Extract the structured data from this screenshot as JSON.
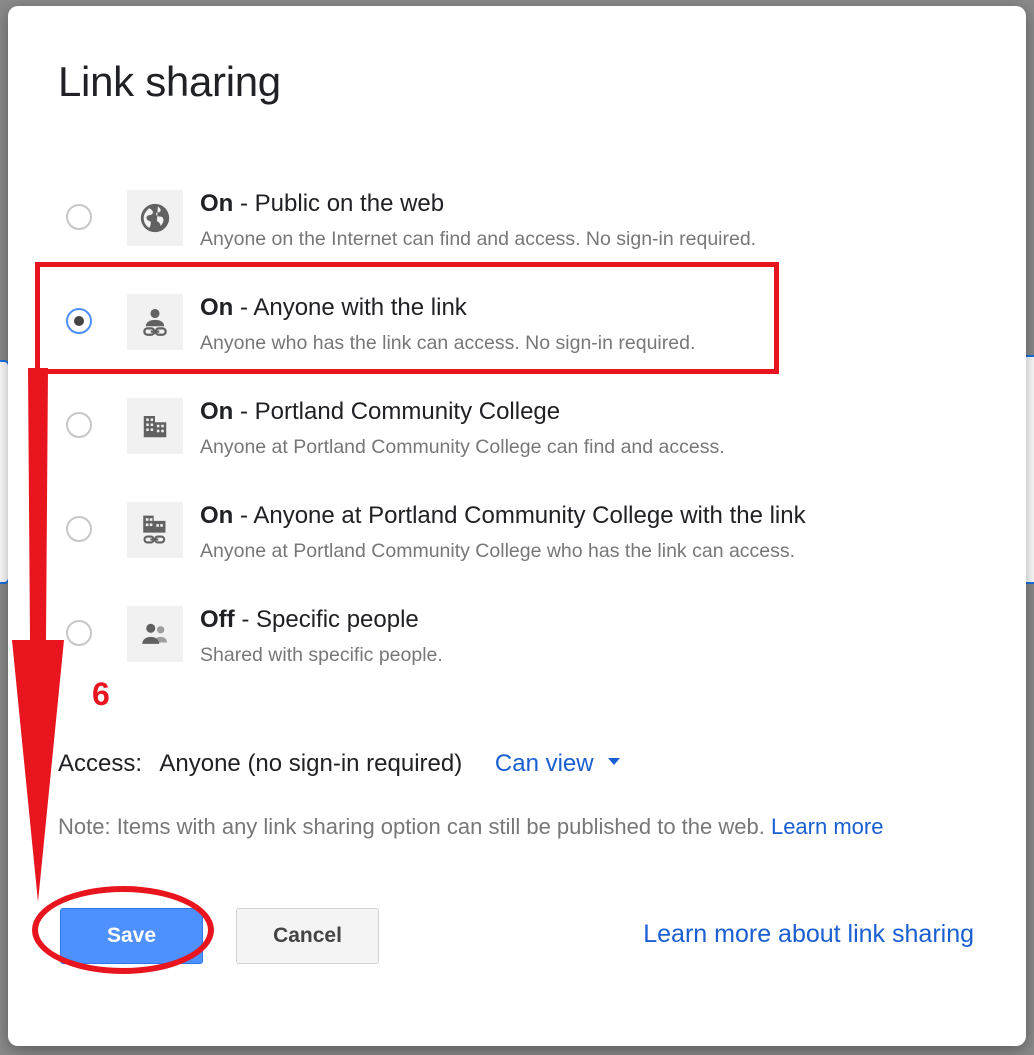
{
  "dialog": {
    "title": "Link sharing"
  },
  "options": [
    {
      "state": "On",
      "label": " - Public on the web",
      "description": "Anyone on the Internet can find and access. No sign-in required.",
      "icon": "globe-icon",
      "selected": false
    },
    {
      "state": "On",
      "label": " - Anyone with the link",
      "description": "Anyone who has the link can access. No sign-in required.",
      "icon": "person-link-icon",
      "selected": true
    },
    {
      "state": "On",
      "label": " - Portland Community College",
      "description": "Anyone at Portland Community College can find and access.",
      "icon": "building-icon",
      "selected": false
    },
    {
      "state": "On",
      "label": " - Anyone at Portland Community College with the link",
      "description": "Anyone at Portland Community College who has the link can access.",
      "icon": "building-link-icon",
      "selected": false
    },
    {
      "state": "Off",
      "label": " - Specific people",
      "description": "Shared with specific people.",
      "icon": "people-icon",
      "selected": false
    }
  ],
  "access": {
    "label": "Access:",
    "value": "Anyone (no sign-in required)",
    "permission": "Can view"
  },
  "note": {
    "text": "Note: Items with any link sharing option can still be published to the web. ",
    "link": "Learn more"
  },
  "buttons": {
    "save": "Save",
    "cancel": "Cancel"
  },
  "footer_link": "Learn more about link sharing",
  "annotation": {
    "step": "6"
  },
  "colors": {
    "accent": "#4d90fe",
    "link": "#1a5fd0",
    "annotation": "#e8141e"
  }
}
